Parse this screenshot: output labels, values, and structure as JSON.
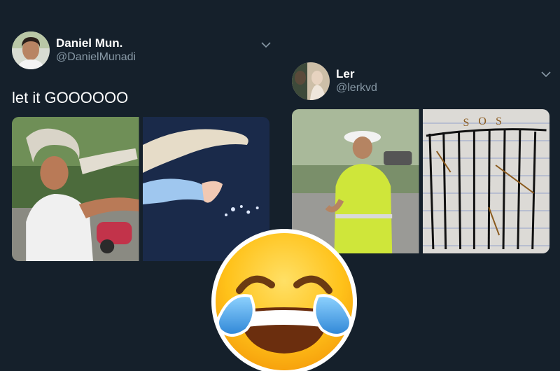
{
  "tweets": [
    {
      "name": "Daniel Mun.",
      "handle": "@DanielMunadi",
      "text": "let it GOOOOOO",
      "media": [
        "person-in-braided-wig-pose",
        "elsa-casting-ice-hand"
      ]
    },
    {
      "name": "Ler",
      "handle": "@lerkvd",
      "text": "",
      "media": [
        "police-officer-writing-notepad",
        "sos-tic-tac-toe-grid-paper"
      ]
    }
  ],
  "overlay": {
    "emoji": "face-with-tears-of-joy-icon"
  },
  "colors": {
    "background": "#15202b",
    "name": "#ffffff",
    "handle": "#8899a6",
    "text": "#ffffff"
  }
}
